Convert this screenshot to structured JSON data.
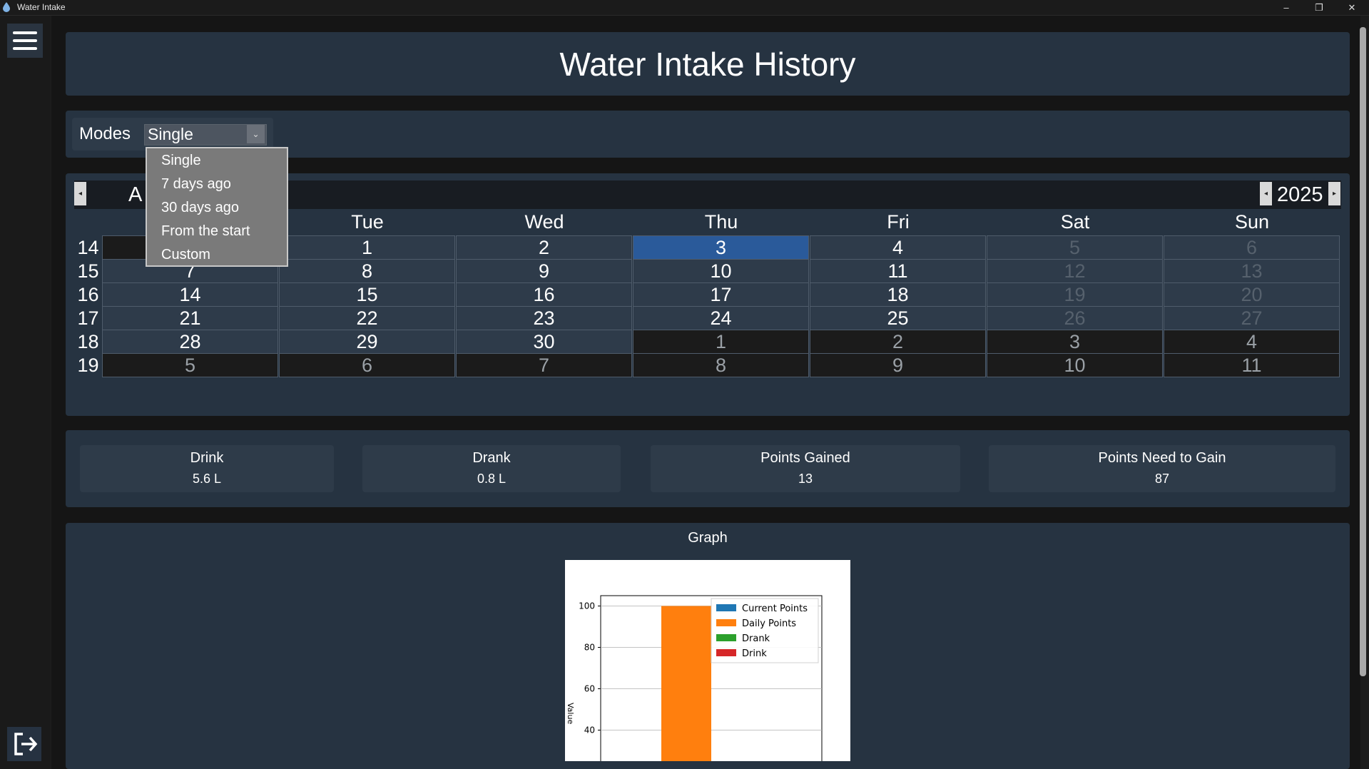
{
  "window": {
    "title": "Water Intake",
    "minimize": "–",
    "restore": "❐",
    "close": "✕"
  },
  "page": {
    "title": "Water Intake History"
  },
  "modes": {
    "label": "Modes",
    "selected": "Single",
    "options": [
      "Single",
      "7 days ago",
      "30 days ago",
      "From the start",
      "Custom"
    ]
  },
  "calendar": {
    "month_visible": "A",
    "year": "2025",
    "weekdays": [
      "",
      "Tue",
      "Wed",
      "Thu",
      "Fri",
      "Sat",
      "Sun"
    ],
    "week_numbers": [
      "14",
      "15",
      "16",
      "17",
      "18",
      "19"
    ],
    "rows": [
      [
        "",
        "1",
        "2",
        "3",
        "4",
        "5",
        "6"
      ],
      [
        "7",
        "8",
        "9",
        "10",
        "11",
        "12",
        "13"
      ],
      [
        "14",
        "15",
        "16",
        "17",
        "18",
        "19",
        "20"
      ],
      [
        "21",
        "22",
        "23",
        "24",
        "25",
        "26",
        "27"
      ],
      [
        "28",
        "29",
        "30",
        "1",
        "2",
        "3",
        "4"
      ],
      [
        "5",
        "6",
        "7",
        "8",
        "9",
        "10",
        "11"
      ]
    ],
    "selected": "3"
  },
  "stats": [
    {
      "label": "Drink",
      "value": "5.6 L"
    },
    {
      "label": "Drank",
      "value": "0.8 L"
    },
    {
      "label": "Points Gained",
      "value": "13"
    },
    {
      "label": "Points Need to Gain",
      "value": "87"
    }
  ],
  "graph": {
    "label": "Graph",
    "colors": {
      "current": "#1f77b4",
      "daily": "#ff7f0e",
      "drank": "#2ca02c",
      "drink": "#d62728"
    }
  },
  "chart_data": {
    "type": "bar",
    "categories": [
      ""
    ],
    "series": [
      {
        "name": "Current Points",
        "values": [
          0
        ]
      },
      {
        "name": "Daily Points",
        "values": [
          100
        ]
      },
      {
        "name": "Drank",
        "values": [
          0
        ]
      },
      {
        "name": "Drink",
        "values": [
          0
        ]
      }
    ],
    "ylabel": "Value",
    "yticks": [
      "100",
      "80",
      "60",
      "40"
    ],
    "ylim": [
      25,
      105
    ],
    "grid": true,
    "legend": "top-right"
  }
}
